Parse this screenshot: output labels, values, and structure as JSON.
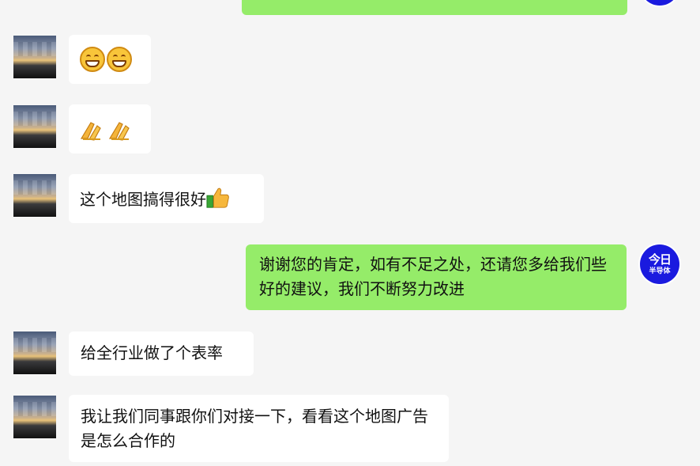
{
  "messages": {
    "m2": {
      "text": ""
    },
    "m3": {
      "text": ""
    },
    "m4": {
      "text": "这个地图搞得很好",
      "emoji": "👍"
    },
    "m5": {
      "text": "谢谢您的肯定，如有不足之处，还请您多给我们些好的建议，我们不断努力改进"
    },
    "m6": {
      "text": "给全行业做了个表率"
    },
    "m7": {
      "text": "我让我们同事跟你们对接一下，看看这个地图广告是怎么合作的"
    }
  },
  "self_avatar": {
    "line1": "今日",
    "line2": "半导体",
    "color": "#1a1adf"
  },
  "colors": {
    "background": "#f5f5f5",
    "outgoing_bubble": "#95ec69",
    "incoming_bubble": "#ffffff"
  },
  "icons": {
    "m2": "grinning-face-emoji",
    "m3": "folded-hands-emoji",
    "m4": "thumbs-up-emoji"
  }
}
